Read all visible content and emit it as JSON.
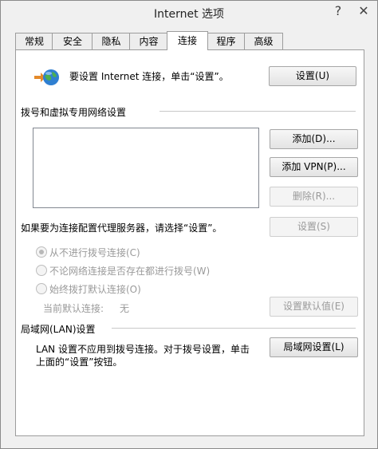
{
  "window": {
    "title": "Internet 选项",
    "help": "?",
    "close": "✕"
  },
  "tabs": [
    {
      "label": "常规"
    },
    {
      "label": "安全"
    },
    {
      "label": "隐私"
    },
    {
      "label": "内容"
    },
    {
      "label": "连接",
      "active": true
    },
    {
      "label": "程序"
    },
    {
      "label": "高级"
    }
  ],
  "setup": {
    "text": "要设置 Internet 连接，单击“设置”。",
    "button": "设置(U)"
  },
  "dialup": {
    "heading": "拨号和虚拟专用网络设置",
    "add_button": "添加(D)...",
    "add_vpn_button": "添加 VPN(P)...",
    "delete_button": "删除(R)...",
    "proxy_text": "如果要为连接配置代理服务器，请选择“设置”。",
    "settings_button": "设置(S)",
    "options": [
      {
        "label": "从不进行拨号连接(C)",
        "checked": true
      },
      {
        "label": "不论网络连接是否存在都进行拨号(W)",
        "checked": false
      },
      {
        "label": "始终拨打默认连接(O)",
        "checked": false
      }
    ],
    "current_default_label": "当前默认连接:",
    "current_default_value": "无",
    "set_default_button": "设置默认值(E)"
  },
  "lan": {
    "heading": "局域网(LAN)设置",
    "text_line1": "LAN 设置不应用到拨号连接。对于拨号设置，单击",
    "text_line2": "上面的“设置”按钮。",
    "button": "局域网设置(L)"
  }
}
